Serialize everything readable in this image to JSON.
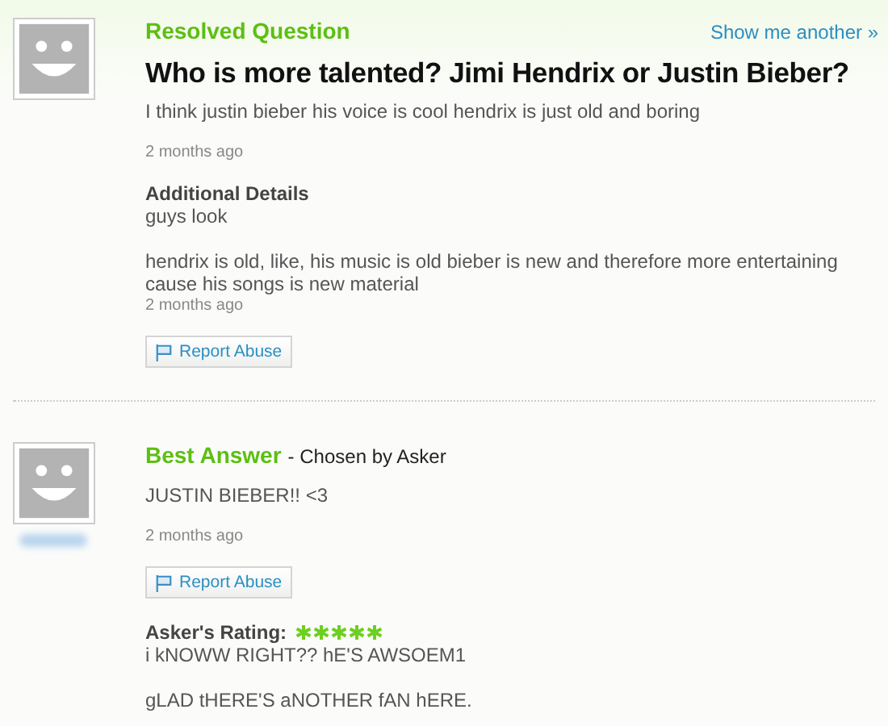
{
  "question": {
    "heading": "Resolved Question",
    "show_another": "Show me another »",
    "title": "Who is more talented? Jimi Hendrix or Justin Bieber?",
    "body": "I think justin bieber his voice is cool hendrix is just old and boring",
    "time": "2 months ago",
    "details_heading": "Additional Details",
    "details": [
      "guys look",
      "hendrix is old, like, his music is old bieber is new and therefore more entertaining cause his songs is new material"
    ],
    "details_time": "2 months ago",
    "report": "Report Abuse"
  },
  "answer": {
    "heading": "Best Answer",
    "chosen": "- Chosen by Asker",
    "body": "JUSTIN BIEBER!! <3",
    "time": "2 months ago",
    "report": "Report Abuse",
    "rating_label": "Asker's Rating:",
    "stars": 5,
    "comment": [
      "i kNOWW RIGHT?? hE'S AWSOEM1",
      "gLAD tHERE'S aNOTHER fAN hERE."
    ]
  }
}
